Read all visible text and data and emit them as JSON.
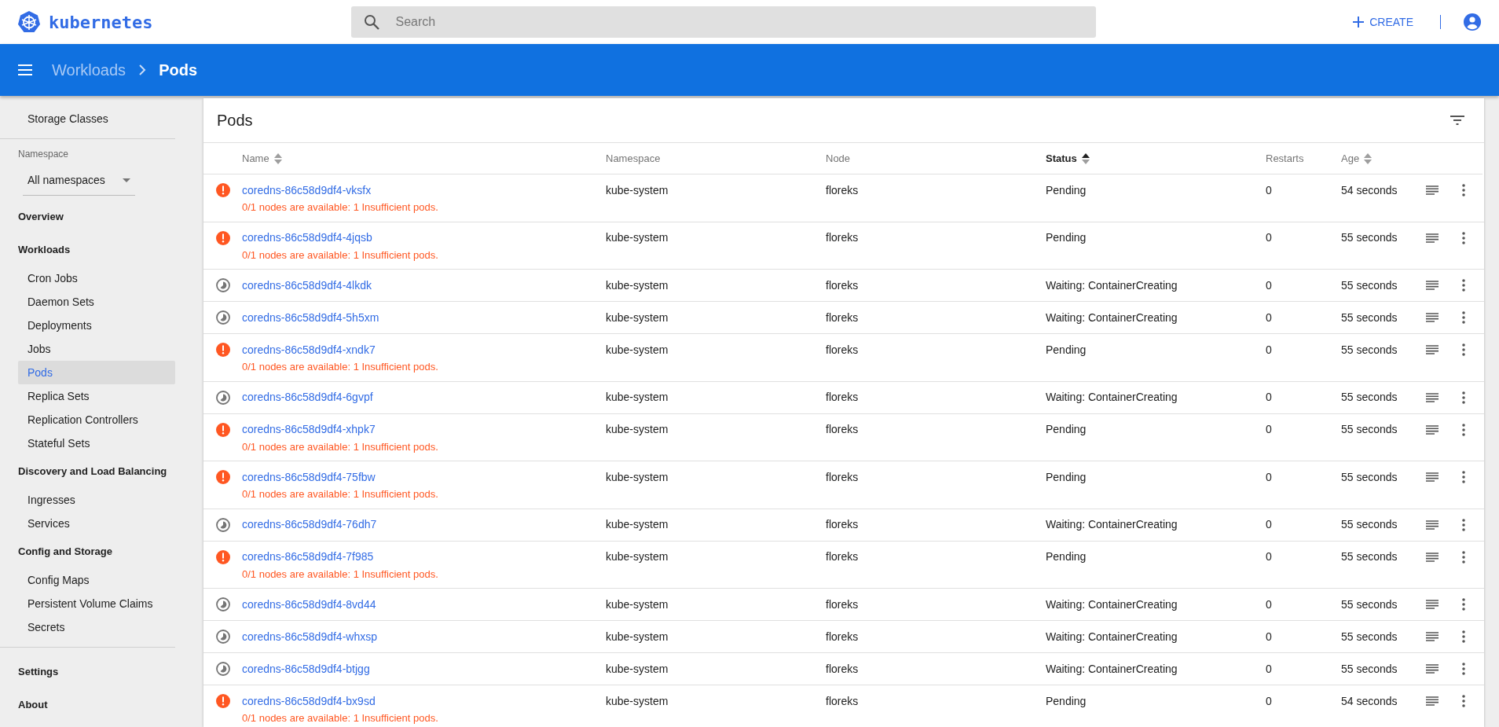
{
  "header": {
    "logo_text": "kubernetes",
    "search": {
      "placeholder": "Search"
    },
    "create_label": "CREATE"
  },
  "breadcrumb": [
    {
      "label": "Workloads",
      "current": false
    },
    {
      "label": "Pods",
      "current": true
    }
  ],
  "sidebar": {
    "top_items": [
      {
        "label": "Storage Classes",
        "selected": false
      }
    ],
    "namespace": {
      "label": "Namespace",
      "value": "All namespaces"
    },
    "groups": [
      {
        "label": "Overview"
      },
      {
        "label": "Workloads",
        "children": [
          {
            "label": "Cron Jobs",
            "selected": false
          },
          {
            "label": "Daemon Sets",
            "selected": false
          },
          {
            "label": "Deployments",
            "selected": false
          },
          {
            "label": "Jobs",
            "selected": false
          },
          {
            "label": "Pods",
            "selected": true
          },
          {
            "label": "Replica Sets",
            "selected": false
          },
          {
            "label": "Replication Controllers",
            "selected": false
          },
          {
            "label": "Stateful Sets",
            "selected": false
          }
        ]
      },
      {
        "label": "Discovery and Load Balancing",
        "children": [
          {
            "label": "Ingresses",
            "selected": false
          },
          {
            "label": "Services",
            "selected": false
          }
        ]
      },
      {
        "label": "Config and Storage",
        "children": [
          {
            "label": "Config Maps",
            "selected": false
          },
          {
            "label": "Persistent Volume Claims",
            "selected": false
          },
          {
            "label": "Secrets",
            "selected": false
          }
        ]
      }
    ],
    "bottom_items": [
      {
        "label": "Settings"
      },
      {
        "label": "About"
      }
    ]
  },
  "table": {
    "title": "Pods",
    "columns": [
      {
        "label": "Name",
        "sortable": true,
        "sorted": false
      },
      {
        "label": "Namespace"
      },
      {
        "label": "Node"
      },
      {
        "label": "Status",
        "sortable": true,
        "sorted": true
      },
      {
        "label": "Restarts"
      },
      {
        "label": "Age",
        "sortable": true,
        "sorted": false
      }
    ],
    "rows": [
      {
        "kind": "error",
        "name": "coredns-86c58d9df4-vksfx",
        "message": "0/1 nodes are available: 1 Insufficient pods.",
        "namespace": "kube-system",
        "node": "floreks",
        "status": "Pending",
        "restarts": "0",
        "age": "54 seconds"
      },
      {
        "kind": "error",
        "name": "coredns-86c58d9df4-4jqsb",
        "message": "0/1 nodes are available: 1 Insufficient pods.",
        "namespace": "kube-system",
        "node": "floreks",
        "status": "Pending",
        "restarts": "0",
        "age": "55 seconds"
      },
      {
        "kind": "waiting",
        "name": "coredns-86c58d9df4-4lkdk",
        "namespace": "kube-system",
        "node": "floreks",
        "status": "Waiting: ContainerCreating",
        "restarts": "0",
        "age": "55 seconds"
      },
      {
        "kind": "waiting",
        "name": "coredns-86c58d9df4-5h5xm",
        "namespace": "kube-system",
        "node": "floreks",
        "status": "Waiting: ContainerCreating",
        "restarts": "0",
        "age": "55 seconds"
      },
      {
        "kind": "error",
        "name": "coredns-86c58d9df4-xndk7",
        "message": "0/1 nodes are available: 1 Insufficient pods.",
        "namespace": "kube-system",
        "node": "floreks",
        "status": "Pending",
        "restarts": "0",
        "age": "55 seconds"
      },
      {
        "kind": "waiting",
        "name": "coredns-86c58d9df4-6gvpf",
        "namespace": "kube-system",
        "node": "floreks",
        "status": "Waiting: ContainerCreating",
        "restarts": "0",
        "age": "55 seconds"
      },
      {
        "kind": "error",
        "name": "coredns-86c58d9df4-xhpk7",
        "message": "0/1 nodes are available: 1 Insufficient pods.",
        "namespace": "kube-system",
        "node": "floreks",
        "status": "Pending",
        "restarts": "0",
        "age": "55 seconds"
      },
      {
        "kind": "error",
        "name": "coredns-86c58d9df4-75fbw",
        "message": "0/1 nodes are available: 1 Insufficient pods.",
        "namespace": "kube-system",
        "node": "floreks",
        "status": "Pending",
        "restarts": "0",
        "age": "55 seconds"
      },
      {
        "kind": "waiting",
        "name": "coredns-86c58d9df4-76dh7",
        "namespace": "kube-system",
        "node": "floreks",
        "status": "Waiting: ContainerCreating",
        "restarts": "0",
        "age": "55 seconds"
      },
      {
        "kind": "error",
        "name": "coredns-86c58d9df4-7f985",
        "message": "0/1 nodes are available: 1 Insufficient pods.",
        "namespace": "kube-system",
        "node": "floreks",
        "status": "Pending",
        "restarts": "0",
        "age": "55 seconds"
      },
      {
        "kind": "waiting",
        "name": "coredns-86c58d9df4-8vd44",
        "namespace": "kube-system",
        "node": "floreks",
        "status": "Waiting: ContainerCreating",
        "restarts": "0",
        "age": "55 seconds"
      },
      {
        "kind": "waiting",
        "name": "coredns-86c58d9df4-whxsp",
        "namespace": "kube-system",
        "node": "floreks",
        "status": "Waiting: ContainerCreating",
        "restarts": "0",
        "age": "55 seconds"
      },
      {
        "kind": "waiting",
        "name": "coredns-86c58d9df4-btjgg",
        "namespace": "kube-system",
        "node": "floreks",
        "status": "Waiting: ContainerCreating",
        "restarts": "0",
        "age": "55 seconds"
      },
      {
        "kind": "error",
        "name": "coredns-86c58d9df4-bx9sd",
        "message": "0/1 nodes are available: 1 Insufficient pods.",
        "namespace": "kube-system",
        "node": "floreks",
        "status": "Pending",
        "restarts": "0",
        "age": "54 seconds"
      }
    ]
  }
}
